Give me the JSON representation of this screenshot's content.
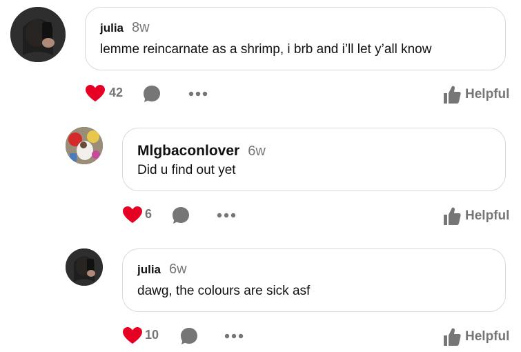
{
  "comments": [
    {
      "username": "julia",
      "time": "8w",
      "text": "lemme reincarnate as a shrimp, i brb and i’ll let y’all know",
      "likes": "42",
      "helpful_label": "Helpful",
      "avatar": "dark-selfie-avatar"
    },
    {
      "username": "Mlgbaconlover",
      "time": "6w",
      "text": "Did u find out yet",
      "likes": "6",
      "helpful_label": "Helpful",
      "avatar": "colorful-avatar"
    },
    {
      "username": "julia",
      "time": "6w",
      "text": "dawg, the colours are sick asf",
      "likes": "10",
      "helpful_label": "Helpful",
      "avatar": "dark-selfie-avatar"
    }
  ],
  "colors": {
    "heart": "#e60023",
    "icon_gray": "#767676",
    "border": "#d9d9d9"
  }
}
